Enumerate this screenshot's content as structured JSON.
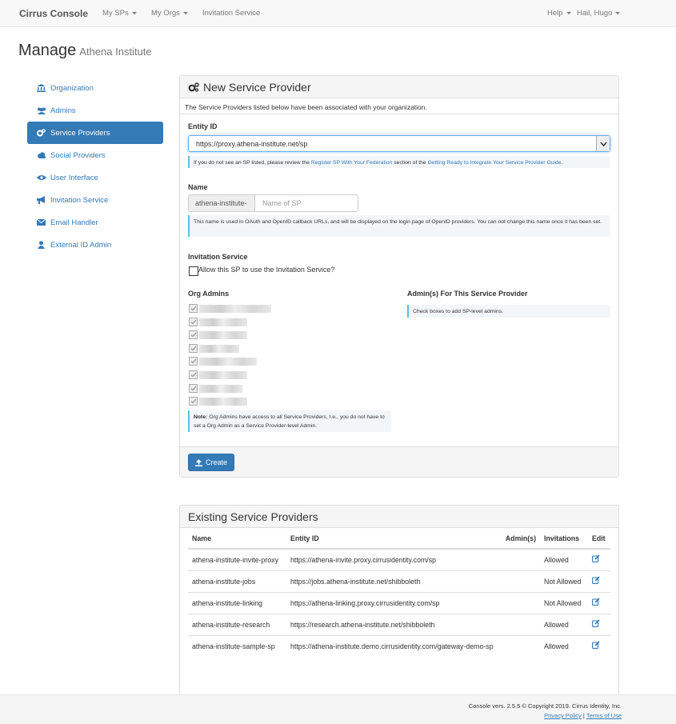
{
  "navbar": {
    "brand": "Cirrus Console",
    "items": [
      "My SPs",
      "My Orgs",
      "Invitation Service"
    ],
    "help": "Help",
    "user": "Hail, Hugo"
  },
  "page": {
    "title": "Manage",
    "subtitle": "Athena Institute"
  },
  "sidebar": {
    "items": [
      {
        "label": "Organization",
        "icon": "bank-icon"
      },
      {
        "label": "Admins",
        "icon": "users-icon"
      },
      {
        "label": "Service Providers",
        "icon": "gears-icon",
        "active": true
      },
      {
        "label": "Social Providers",
        "icon": "cloud-icon"
      },
      {
        "label": "User Interface",
        "icon": "eye-icon"
      },
      {
        "label": "Invitation Service",
        "icon": "bullhorn-icon"
      },
      {
        "label": "Email Handler",
        "icon": "envelope-icon"
      },
      {
        "label": "External ID Admin",
        "icon": "user-icon"
      }
    ]
  },
  "new_sp": {
    "title": "New Service Provider",
    "intro": "The Service Providers listed below have been associated with your organization.",
    "entity_label": "Entity ID",
    "entity_value": "https://proxy.athena-institute.net/sp",
    "entity_help_pre": "If you do not see an SP listed, please review the ",
    "entity_help_link1": "Register SP With Your Federation",
    "entity_help_mid": " section of the ",
    "entity_help_link2": "Getting Ready to Integrate Your Service Provider Guide",
    "entity_help_post": ".",
    "name_label": "Name",
    "name_prefix": "athena-institute-",
    "name_placeholder": "Name of SP",
    "name_help": "This name is used in OAuth and OpenID callback URLs, and will be displayed on the login page of OpenID providers. You can not change this name once it has been set.",
    "invitation_label": "Invitation Service",
    "invitation_checkbox": "Allow this SP to use the Invitation Service?",
    "org_admins_label": "Org Admins",
    "org_admins_note_bold": "Note:",
    "org_admins_note": " Org Admins have access to all Service Providers, I.e., you do not have to set a Org Admin as a Service Provider-level Admin.",
    "sp_admins_label": "Admin(s) For This Service Provider",
    "sp_admins_help": "Check boxes to add SP-level admins.",
    "create_button": "Create"
  },
  "existing": {
    "title": "Existing Service Providers",
    "columns": [
      "Name",
      "Entity ID",
      "Admin(s)",
      "Invitations",
      "Edit"
    ],
    "rows": [
      {
        "name": "athena-institute-invite-proxy",
        "entity": "https://athena-invite.proxy.cirrusidentity.com/sp",
        "admins": "",
        "invitations": "Allowed"
      },
      {
        "name": "athena-institute-jobs",
        "entity": "https://jobs.athena-institute.net/shibboleth",
        "admins": "",
        "invitations": "Not Allowed"
      },
      {
        "name": "athena-institute-linking",
        "entity": "https://athena-linking.proxy.cirrusidentity.com/sp",
        "admins": "",
        "invitations": "Not Allowed"
      },
      {
        "name": "athena-institute-research",
        "entity": "https://research.athena-institute.net/shibboleth",
        "admins": "",
        "invitations": "Allowed"
      },
      {
        "name": "athena-institute-sample-sp",
        "entity": "https://athena-institute.demo.cirrusidentity.com/gateway-demo-sp",
        "admins": "",
        "invitations": "Allowed"
      }
    ]
  },
  "footer": {
    "version": "Console vers. 2.5.5 © Copyright 2019. Cirrus Identity, Inc.",
    "privacy": "Privacy Policy",
    "separator": "|",
    "terms": "Terms of Use"
  },
  "colors": {
    "primary": "#337ab7",
    "info_border": "#5bc0de"
  }
}
